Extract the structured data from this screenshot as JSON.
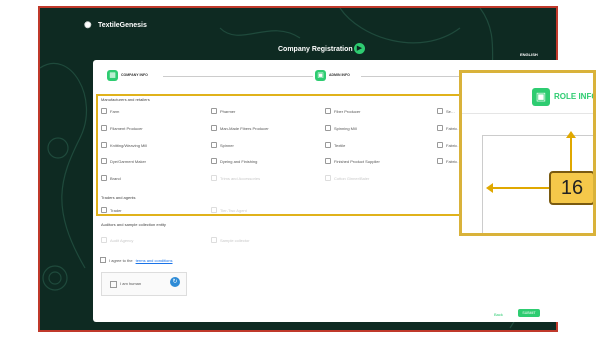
{
  "app": {
    "name": "TextileGenesis",
    "lang": "ENGLISH"
  },
  "page_title": "Company Registration",
  "steps": [
    {
      "label": "COMPANY INFO"
    },
    {
      "label": "ADMIN INFO"
    }
  ],
  "sections": {
    "manufacturers": {
      "title": "Manufacturers and retailers",
      "items": [
        "Farm",
        "Pharmer",
        "Fiber Producer",
        "Se…",
        "Filament Producer",
        "Man-Made Fibers Producer",
        "Spinning Mill",
        "Fabric…",
        "Knitting/Weaving Mill",
        "Spinner",
        "Textile",
        "Fabric…",
        "Dye/Garment Maker",
        "Dyeing and Finishing",
        "Finished Product Supplier",
        "Fabric…",
        "Brand",
        "Trims and Accessories",
        "Cotton Ginner/Baler",
        ""
      ]
    },
    "traders": {
      "title": "Traders and agents",
      "items": [
        "Trader",
        "Tier-Two Agent"
      ]
    },
    "auditors": {
      "title": "Auditors and sample collection entity",
      "items": [
        "Audit Agency",
        "Sample collector"
      ]
    }
  },
  "terms": {
    "prefix": "I agree to the",
    "link": "terms and conditions"
  },
  "captcha": {
    "label": "I am human"
  },
  "buttons": {
    "back": "Back",
    "submit": "SUBMIT"
  },
  "zoom": {
    "label": "ROLE INFO",
    "number": "16"
  },
  "colors": {
    "accent": "#2ecc71",
    "bg": "#0e2a22",
    "highlight": "#e0b21b"
  }
}
